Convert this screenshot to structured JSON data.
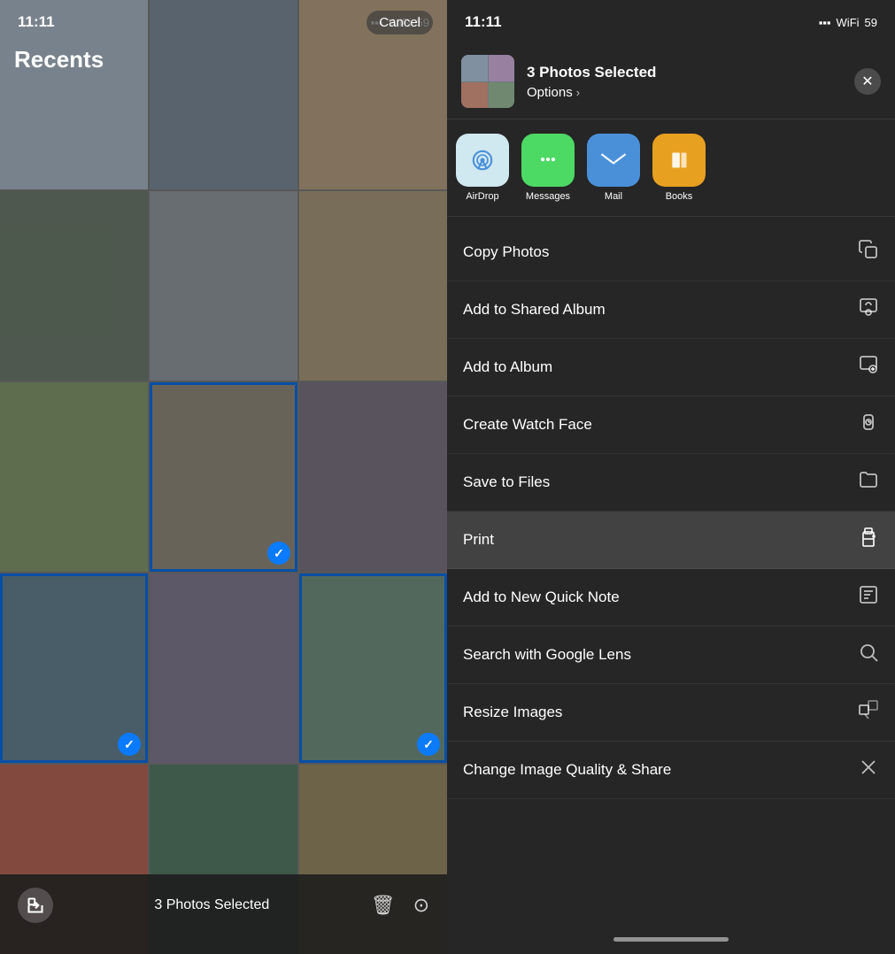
{
  "left": {
    "status_time": "11:11",
    "recents_label": "Recents",
    "cancel_label": "Cancel",
    "selected_count": "3 Photos Selected"
  },
  "right": {
    "status_time": "11:11",
    "header": {
      "title": "3 Photos Selected",
      "options_label": "Options",
      "options_chevron": "›"
    },
    "close_icon": "✕",
    "apps": [
      {
        "id": "airdrop",
        "label": "AirDrop",
        "icon": "📡"
      },
      {
        "id": "messages",
        "label": "Messages",
        "icon": "💬"
      },
      {
        "id": "mail",
        "label": "Mail",
        "icon": "✉️"
      },
      {
        "id": "books",
        "label": "Books",
        "icon": "📖"
      }
    ],
    "actions": [
      {
        "id": "copy-photos",
        "label": "Copy Photos",
        "icon": "⎘",
        "highlighted": false
      },
      {
        "id": "add-shared-album",
        "label": "Add to Shared Album",
        "icon": "👤",
        "highlighted": false
      },
      {
        "id": "add-album",
        "label": "Add to Album",
        "icon": "➕",
        "highlighted": false
      },
      {
        "id": "create-watch-face",
        "label": "Create Watch Face",
        "icon": "⌚",
        "highlighted": false
      },
      {
        "id": "save-files",
        "label": "Save to Files",
        "icon": "📁",
        "highlighted": false
      },
      {
        "id": "print",
        "label": "Print",
        "icon": "🖨",
        "highlighted": true
      },
      {
        "id": "quick-note",
        "label": "Add to New Quick Note",
        "icon": "📝",
        "highlighted": false
      },
      {
        "id": "google-lens",
        "label": "Search with Google Lens",
        "icon": "🔍",
        "highlighted": false
      },
      {
        "id": "resize-images",
        "label": "Resize Images",
        "icon": "⧉",
        "highlighted": false
      },
      {
        "id": "change-quality",
        "label": "Change Image Quality & Share",
        "icon": "⤢",
        "highlighted": false
      }
    ]
  }
}
